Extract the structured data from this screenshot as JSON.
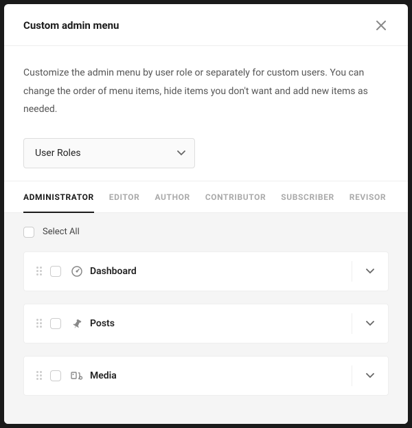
{
  "header": {
    "title": "Custom admin menu"
  },
  "description": "Customize the admin menu by user role or separately for custom users. You can change the order of menu items, hide items you don't want and add new items as needed.",
  "selector": {
    "value": "User Roles"
  },
  "tabs": [
    {
      "label": "ADMINISTRATOR",
      "active": true
    },
    {
      "label": "EDITOR",
      "active": false
    },
    {
      "label": "AUTHOR",
      "active": false
    },
    {
      "label": "CONTRIBUTOR",
      "active": false
    },
    {
      "label": "SUBSCRIBER",
      "active": false
    },
    {
      "label": "REVISOR",
      "active": false
    }
  ],
  "selectAll": {
    "label": "Select All"
  },
  "items": [
    {
      "label": "Dashboard",
      "icon": "dashboard"
    },
    {
      "label": "Posts",
      "icon": "pin"
    },
    {
      "label": "Media",
      "icon": "media"
    }
  ]
}
